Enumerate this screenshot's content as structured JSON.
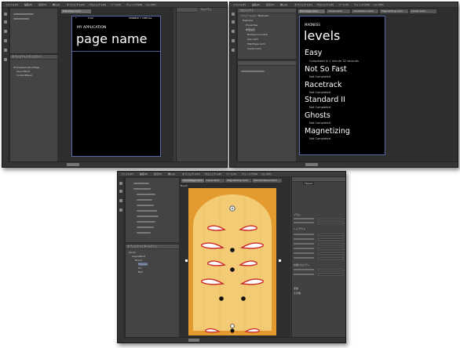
{
  "menu_items": [
    "ファイル(F)",
    "編集(E)",
    "表示(V)",
    "挿入(I)",
    "オブジェクト(O)",
    "プロジェクト(P)",
    "ツール(T)",
    "ウィンドウ(W)",
    "ヘルプ(H)"
  ],
  "shot1": {
    "tab_label": "MainPage.xaml",
    "status_left": "*",
    "status_time": "5:00",
    "status_right": "VMSIBLE 7 VIRTUAL",
    "app_title": "MY APPLICATION",
    "page_title": "page name",
    "panel_label": "オブジェクトとタイムライン",
    "tree_items": [
      "PhoneApplicationPage",
      "LayoutRoot",
      "ContentPanel"
    ],
    "right_header": "プロパティ"
  },
  "shot2": {
    "tabs": [
      "MainPage.xaml",
      "Levels.xaml",
      "LevelsMenu.xaml",
      "Magnetizing.xaml",
      "Level1.xaml"
    ],
    "panel_label": "プロジェクト",
    "tree_items": [
      "ソリューション 'Madness'",
      "Madness",
      "Properties",
      "参照設定",
      "Background.xaml",
      "App.xaml",
      "MainPage.xaml",
      "Levels.xaml"
    ],
    "app_title": "MADNESS",
    "page_title": "levels",
    "levels": [
      {
        "name": "Easy",
        "status": "Completed in 1 minute 32 seconds"
      },
      {
        "name": "Not So Fast",
        "status": "Not Completed"
      },
      {
        "name": "Racetrack",
        "status": "Not Completed"
      },
      {
        "name": "Standard II",
        "status": "Not Completed"
      },
      {
        "name": "Ghosts",
        "status": "Not Completed"
      },
      {
        "name": "Magnetizing",
        "status": "Not Completed"
      }
    ]
  },
  "shot3": {
    "tabs": [
      "GamePage.xaml",
      "Level.xaml",
      "Magnetizing.xaml",
      "StandardLevel.xaml"
    ],
    "canvas_label": "Board",
    "panel_label": "オブジェクトとタイムライン",
    "tree_items": [
      "[Grid]",
      "LayoutRoot",
      "Board",
      "Flippers",
      "Pin",
      "Ball"
    ],
    "props_name": "Flipper",
    "props_sections": [
      "ブラシ",
      "レイアウト",
      "共通プロパティ",
      "変換",
      "その他"
    ],
    "colors": {
      "board_outer": "#e39a2f",
      "board_inner": "#f3cb74",
      "flipper_fill": "#ffffff",
      "flipper_border": "#cc2a2a",
      "hole": "#111111"
    }
  }
}
